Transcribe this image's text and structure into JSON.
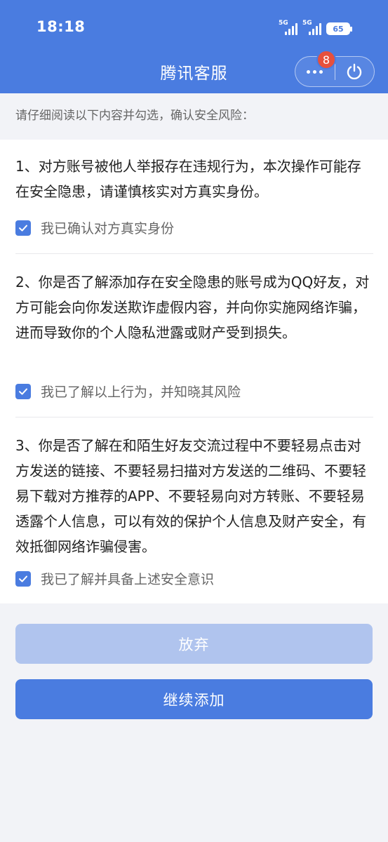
{
  "status_bar": {
    "time": "18:18",
    "network_1": "5G",
    "network_2": "5G",
    "battery": "65"
  },
  "header": {
    "title": "腾讯客服",
    "badge_count": "8",
    "more_icon": "more-dots-icon",
    "power_icon": "power-icon"
  },
  "intro": "请仔细阅读以下内容并勾选，确认安全风险：",
  "items": [
    {
      "text": "1、对方账号被他人举报存在违规行为，本次操作可能存在安全隐患，请谨慎核实对方真实身份。",
      "check_label": "我已确认对方真实身份",
      "checked": true
    },
    {
      "text": "2、你是否了解添加存在安全隐患的账号成为QQ好友，对方可能会向你发送欺诈虚假内容，并向你实施网络诈骗，进而导致你的个人隐私泄露或财产受到损失。",
      "check_label": "我已了解以上行为，并知晓其风险",
      "checked": true
    },
    {
      "text": "3、你是否了解在和陌生好友交流过程中不要轻易点击对方发送的链接、不要轻易扫描对方发送的二维码、不要轻易下载对方推荐的APP、不要轻易向对方转账、不要轻易透露个人信息，可以有效的保护个人信息及财产安全，有效抵御网络诈骗侵害。",
      "check_label": "我已了解并具备上述安全意识",
      "checked": true
    }
  ],
  "buttons": {
    "give_up": "放弃",
    "continue": "继续添加"
  },
  "colors": {
    "accent": "#4a7ce0",
    "accent_disabled": "#b0c4ee",
    "badge": "#e6503c"
  }
}
